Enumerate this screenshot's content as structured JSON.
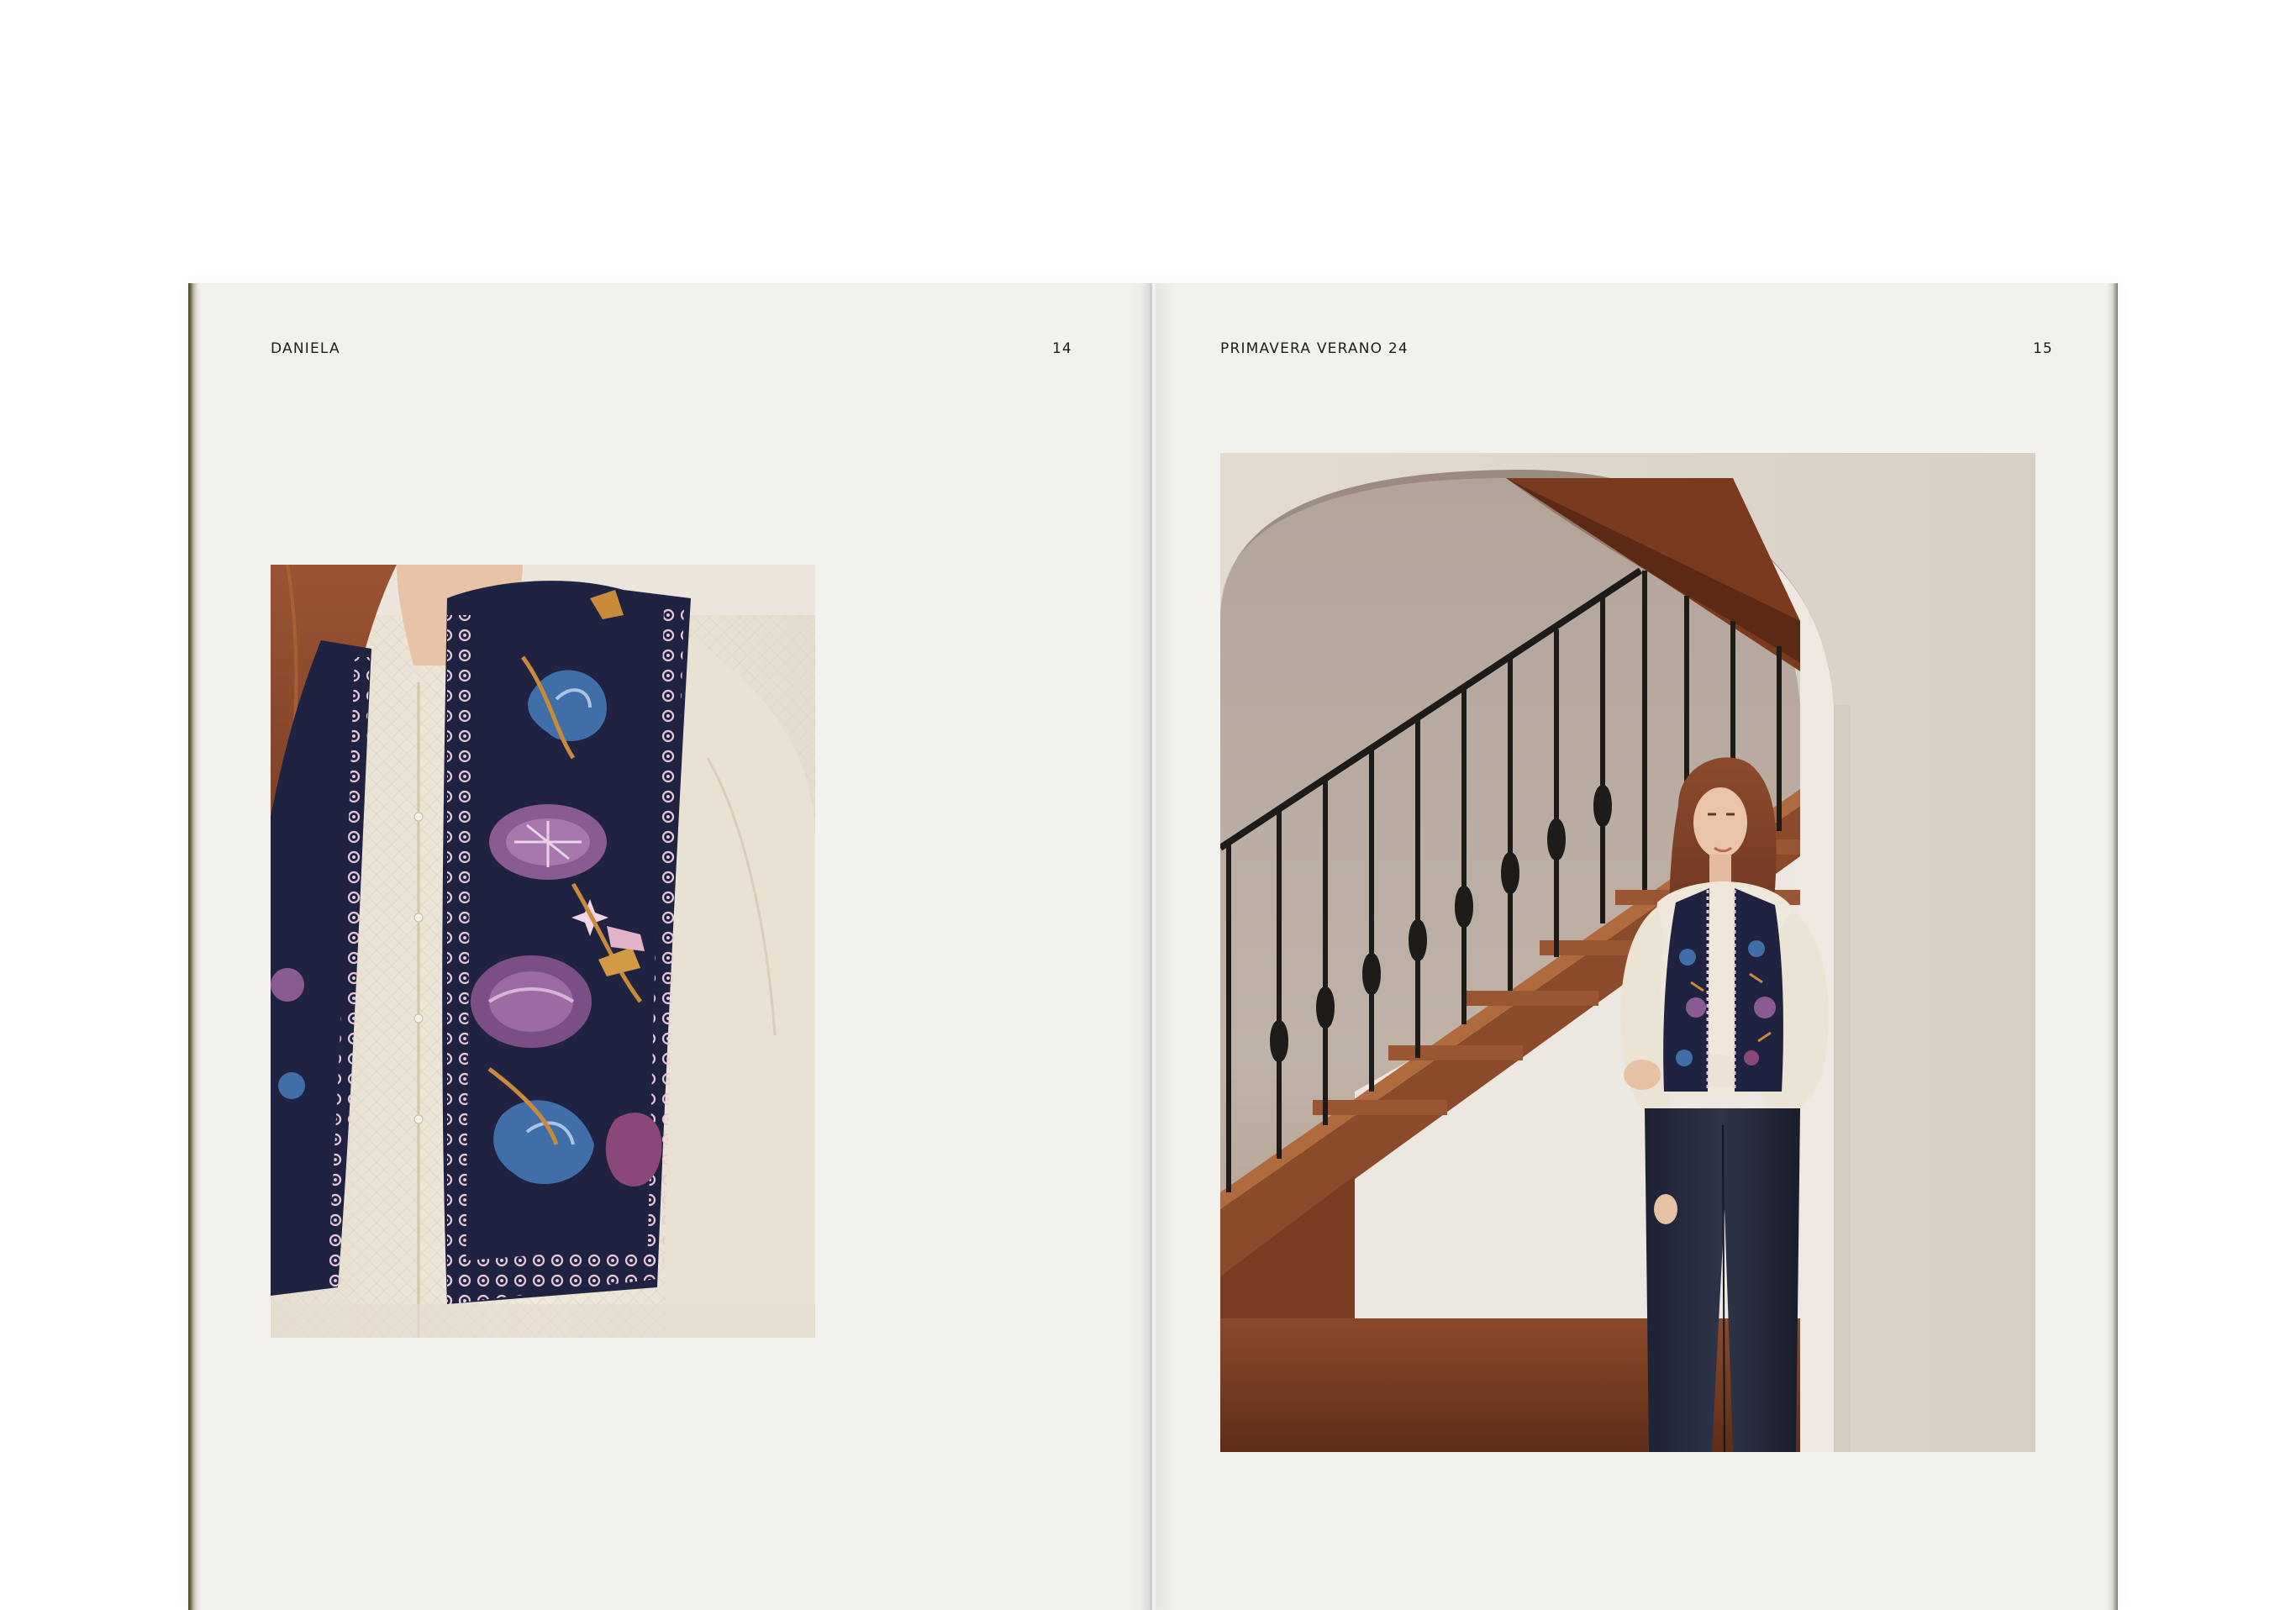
{
  "spread": {
    "left_page": {
      "running_head": "DANIELA",
      "folio": "14",
      "image_icon": "embroidered-vest-closeup-photo"
    },
    "right_page": {
      "running_head": "PRIMAVERA VERANO 24",
      "folio": "15",
      "image_icon": "model-in-archway-staircase-photo"
    }
  },
  "colors": {
    "paper": "#f3f1ee",
    "text": "#1d1d1b",
    "vest_navy": "#1f2240",
    "embroidery_purple": "#8a5a92",
    "embroidery_blue": "#3f6ea8",
    "embroidery_ochre": "#c98a3a",
    "blouse_cream": "#ece5d6",
    "hair": "#8a4a2a",
    "wall": "#ece6df",
    "wood": "#7a3a1e"
  }
}
